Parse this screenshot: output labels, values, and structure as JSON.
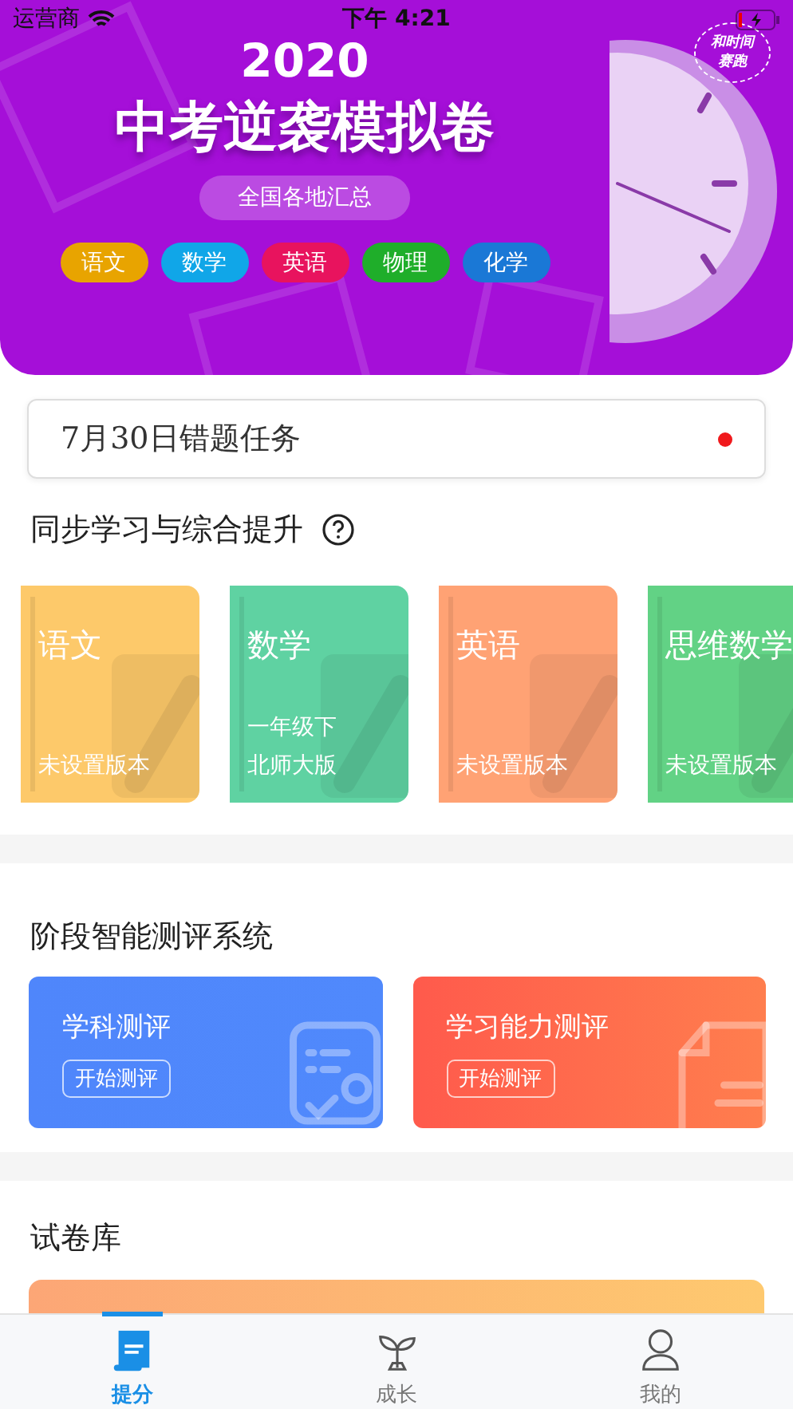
{
  "status_bar": {
    "carrier": "运营商",
    "time": "下午 4:21"
  },
  "banner": {
    "year": "2020",
    "title": "中考逆袭模拟卷",
    "subtitle": "全国各地汇总",
    "slogan": "和时间赛跑",
    "subjects": [
      {
        "label": "语文",
        "color": "#e8a400"
      },
      {
        "label": "数学",
        "color": "#10a6e8"
      },
      {
        "label": "英语",
        "color": "#e8135e"
      },
      {
        "label": "物理",
        "color": "#1fae2a"
      },
      {
        "label": "化学",
        "color": "#1a78d6"
      }
    ]
  },
  "task": {
    "label": "7月30日错题任务",
    "unread": true
  },
  "sync_section": {
    "title": "同步学习与综合提升",
    "books": [
      {
        "subject": "语文",
        "version_lines": [
          "未设置版本"
        ],
        "color": "#fdc96a"
      },
      {
        "subject": "数学",
        "version_lines": [
          "一年级下",
          "北师大版"
        ],
        "color": "#5fd2a2"
      },
      {
        "subject": "英语",
        "version_lines": [
          "未设置版本"
        ],
        "color": "#ffa274"
      },
      {
        "subject": "思维数学",
        "version_lines": [
          "未设置版本"
        ],
        "color": "#62d285"
      }
    ]
  },
  "assessment_section": {
    "title": "阶段智能测评系统",
    "cards": [
      {
        "kind": "subject",
        "title": "学科测评",
        "button": "开始测评"
      },
      {
        "kind": "ability",
        "title": "学习能力测评",
        "button": "开始测评"
      }
    ]
  },
  "library_section": {
    "title": "试卷库"
  },
  "tab_bar": [
    {
      "kind": "score",
      "label": "提分",
      "selected": true
    },
    {
      "kind": "growth",
      "label": "成长",
      "selected": false
    },
    {
      "kind": "profile",
      "label": "我的",
      "selected": false
    }
  ]
}
